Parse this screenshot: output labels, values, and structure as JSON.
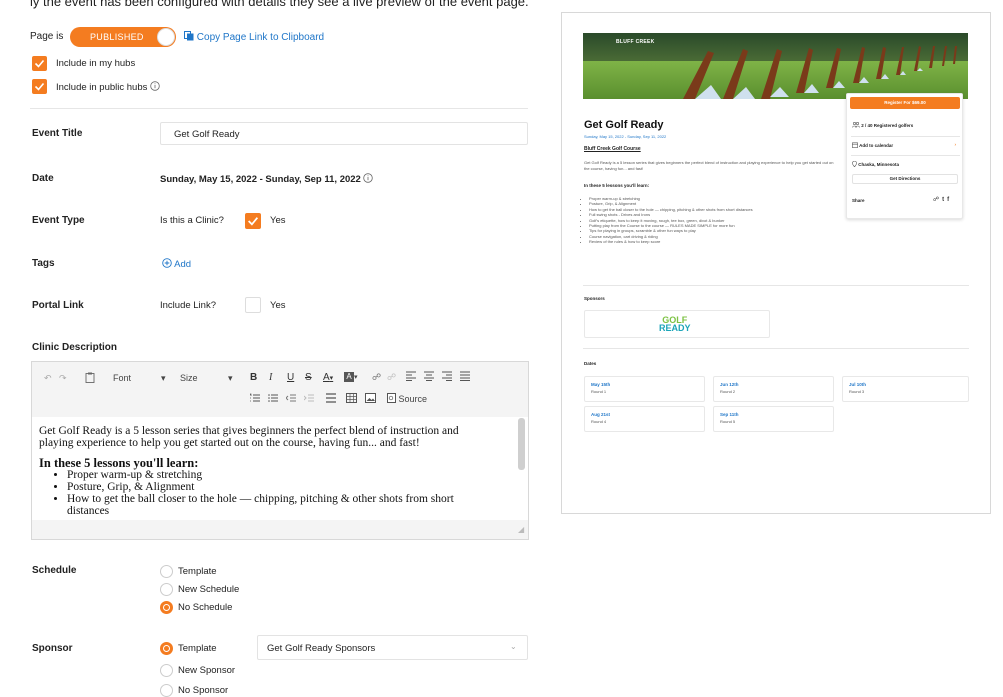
{
  "top_cut_text": "ly the event has been configured with details they see a live preview of the event page.",
  "publish": {
    "page_is_label": "Page is",
    "status": "PUBLISHED",
    "copy_link": "Copy Page Link to Clipboard",
    "include_my_hubs": "Include in my hubs",
    "include_public_hubs": "Include in public hubs"
  },
  "form": {
    "event_title_label": "Event Title",
    "event_title_value": "Get Golf Ready",
    "date_label": "Date",
    "date_value": "Sunday, May 15, 2022 - Sunday, Sep 11, 2022",
    "event_type_label": "Event Type",
    "clinic_question": "Is this a Clinic?",
    "clinic_yes": "Yes",
    "tags_label": "Tags",
    "tags_add": "Add",
    "portal_label": "Portal Link",
    "portal_question": "Include Link?",
    "portal_yes": "Yes",
    "clinic_desc_label": "Clinic Description"
  },
  "editor": {
    "font": "Font",
    "size": "Size",
    "source": "Source",
    "para1": "Get Golf Ready is a 5 lesson series that gives beginners the perfect blend of instruction and playing experience to help you get started out on the course, having fun... and fast!",
    "heading": "In these 5 lessons you'll learn:",
    "bullets": [
      "Proper warm-up & stretching",
      "Posture, Grip, & Alignment",
      "How to get the ball closer to the hole — chipping, pitching & other shots from short distances"
    ]
  },
  "schedule": {
    "label": "Schedule",
    "options": [
      "Template",
      "New Schedule",
      "No Schedule"
    ],
    "selected": 2
  },
  "sponsor": {
    "label": "Sponsor",
    "options": [
      "Template",
      "New Sponsor",
      "No Sponsor"
    ],
    "selected": 0,
    "select_value": "Get Golf Ready Sponsors"
  },
  "preview": {
    "brand": "BLUFF CREEK",
    "register": "Register For $69.00",
    "title": "Get Golf Ready",
    "date_line": "Sunday, May 15, 2022 - Sunday, Sep 11, 2022",
    "course": "Bluff Creek Golf Course",
    "intro": "Get Golf Ready is a 5 lesson series that gives beginners the perfect blend of instruction and playing experience to help you get started out on the course, having fun... and fast!",
    "learn_heading": "In these 5 lessons you'll learn:",
    "learn_items": [
      "Proper warm-up & stretching",
      "Posture, Grip, & Alignment",
      "How to get the ball closer to the hole — chipping, pitching & other shots from short distances",
      "Full swing shots - Drives and Irons",
      "Golf's etiquette, how to keep it moving, rough, tee box, green, divot & bunker",
      "Putting play from the Course to the course — RULES MADE SIMPLE for more fun",
      "Tips for playing in groups, scramble & other fun ways to play",
      "Course navigation, cart driving & riding",
      "Review of the rules & how to keep score"
    ],
    "registered": "2 / 40 Registered golfers",
    "calendar": "Add to calendar",
    "location": "Chaska, Minnesota",
    "directions": "Get Directions",
    "share": "Share",
    "sponsors_label": "Sponsors",
    "sponsor_logo_top": "GOLF",
    "sponsor_logo_bottom": "READY",
    "dates_label": "Dates",
    "dates": [
      {
        "date": "May 15th",
        "round": "Round 1"
      },
      {
        "date": "Jun 12th",
        "round": "Round 2"
      },
      {
        "date": "Jul 10th",
        "round": "Round 3"
      },
      {
        "date": "Aug 21st",
        "round": "Round 4"
      },
      {
        "date": "Sep 11th",
        "round": "Round 5"
      }
    ]
  },
  "colors": {
    "accent": "#f47c20",
    "link": "#1f76c8"
  }
}
